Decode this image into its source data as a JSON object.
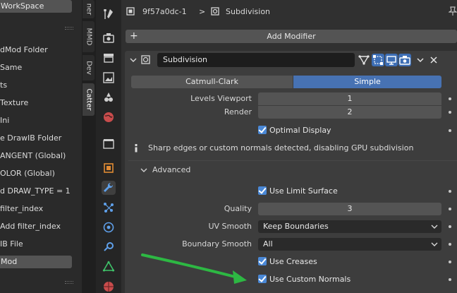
{
  "left_panel": {
    "workspace_label": "WorkSpace",
    "items": [
      "dMod Folder",
      "Same",
      "ts",
      " Texture",
      "Ini",
      "e DrawIB Folder",
      "ANGENT (Global)",
      "OLOR (Global)",
      "d DRAW_TYPE = 1",
      " filter_index",
      "Add filter_index",
      "IB File"
    ],
    "mod_label": "Mod"
  },
  "vertical_tabs": [
    "ner",
    "MMD",
    "Dev",
    "Catter"
  ],
  "property_icons": [
    "tool-icon",
    "render-icon",
    "output-icon",
    "view-layer-icon",
    "scene-icon",
    "world-icon",
    "collection-icon",
    "object-icon",
    "modifiers-icon",
    "particles-icon",
    "physics-icon",
    "constraints-icon",
    "data-icon",
    "material-icon"
  ],
  "header": {
    "object_name": "9f57a0dc-1",
    "separator": ">",
    "modifier_name": "Subdivision"
  },
  "add_modifier_label": "Add Modifier",
  "modifier": {
    "name": "Subdivision",
    "type_options": [
      "Catmull-Clark",
      "Simple"
    ],
    "selected_type": "Simple",
    "levels_viewport_label": "Levels Viewport",
    "levels_viewport_value": "1",
    "render_label": "Render",
    "render_value": "2",
    "optimal_display_label": "Optimal Display",
    "info_text": "Sharp edges or custom normals detected, disabling GPU subdivision",
    "advanced_label": "Advanced",
    "use_limit_surface_label": "Use Limit Surface",
    "quality_label": "Quality",
    "quality_value": "3",
    "uv_smooth_label": "UV Smooth",
    "uv_smooth_value": "Keep Boundaries",
    "boundary_smooth_label": "Boundary Smooth",
    "boundary_smooth_value": "All",
    "use_creases_label": "Use Creases",
    "use_custom_normals_label": "Use Custom Normals"
  },
  "colors": {
    "accent_blue": "#4772b3",
    "annotation_arrow": "#2db843"
  }
}
